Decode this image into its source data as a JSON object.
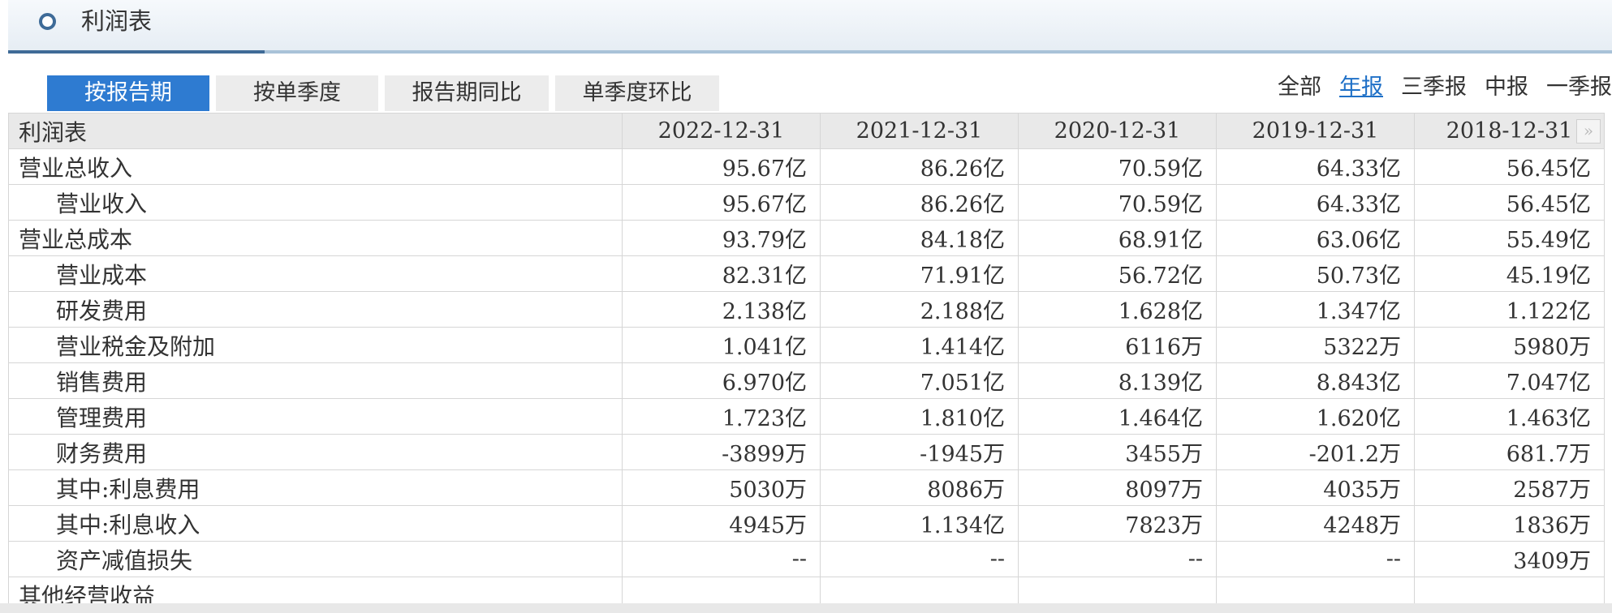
{
  "header": {
    "title": "利润表"
  },
  "tabs": [
    {
      "label": "按报告期",
      "active": true
    },
    {
      "label": "按单季度",
      "active": false
    },
    {
      "label": "报告期同比",
      "active": false
    },
    {
      "label": "单季度环比",
      "active": false
    }
  ],
  "periods": [
    {
      "label": "全部",
      "active": false
    },
    {
      "label": "年报",
      "active": true
    },
    {
      "label": "三季报",
      "active": false
    },
    {
      "label": "中报",
      "active": false
    },
    {
      "label": "一季报",
      "active": false
    }
  ],
  "table": {
    "corner": "利润表",
    "columns": [
      "2022-12-31",
      "2021-12-31",
      "2020-12-31",
      "2019-12-31",
      "2018-12-31"
    ],
    "next_icon": "double-chevron-right-icon",
    "rows": [
      {
        "label": "营业总收入",
        "indent": false,
        "values": [
          "95.67亿",
          "86.26亿",
          "70.59亿",
          "64.33亿",
          "56.45亿"
        ]
      },
      {
        "label": "营业收入",
        "indent": true,
        "values": [
          "95.67亿",
          "86.26亿",
          "70.59亿",
          "64.33亿",
          "56.45亿"
        ]
      },
      {
        "label": "营业总成本",
        "indent": false,
        "values": [
          "93.79亿",
          "84.18亿",
          "68.91亿",
          "63.06亿",
          "55.49亿"
        ]
      },
      {
        "label": "营业成本",
        "indent": true,
        "values": [
          "82.31亿",
          "71.91亿",
          "56.72亿",
          "50.73亿",
          "45.19亿"
        ]
      },
      {
        "label": "研发费用",
        "indent": true,
        "values": [
          "2.138亿",
          "2.188亿",
          "1.628亿",
          "1.347亿",
          "1.122亿"
        ]
      },
      {
        "label": "营业税金及附加",
        "indent": true,
        "values": [
          "1.041亿",
          "1.414亿",
          "6116万",
          "5322万",
          "5980万"
        ]
      },
      {
        "label": "销售费用",
        "indent": true,
        "values": [
          "6.970亿",
          "7.051亿",
          "8.139亿",
          "8.843亿",
          "7.047亿"
        ]
      },
      {
        "label": "管理费用",
        "indent": true,
        "values": [
          "1.723亿",
          "1.810亿",
          "1.464亿",
          "1.620亿",
          "1.463亿"
        ]
      },
      {
        "label": "财务费用",
        "indent": true,
        "values": [
          "-3899万",
          "-1945万",
          "3455万",
          "-201.2万",
          "681.7万"
        ]
      },
      {
        "label": "其中:利息费用",
        "indent": true,
        "values": [
          "5030万",
          "8086万",
          "8097万",
          "4035万",
          "2587万"
        ]
      },
      {
        "label": "其中:利息收入",
        "indent": true,
        "values": [
          "4945万",
          "1.134亿",
          "7823万",
          "4248万",
          "1836万"
        ]
      },
      {
        "label": "资产减值损失",
        "indent": true,
        "values": [
          "--",
          "--",
          "--",
          "--",
          "3409万"
        ]
      },
      {
        "label": "其他经营收益",
        "indent": false,
        "values": [
          "",
          "",
          "",
          "",
          ""
        ]
      }
    ]
  },
  "colors": {
    "accent": "#2e7bd1",
    "link": "#1f70c7",
    "header_bar": "#3f6b97"
  }
}
